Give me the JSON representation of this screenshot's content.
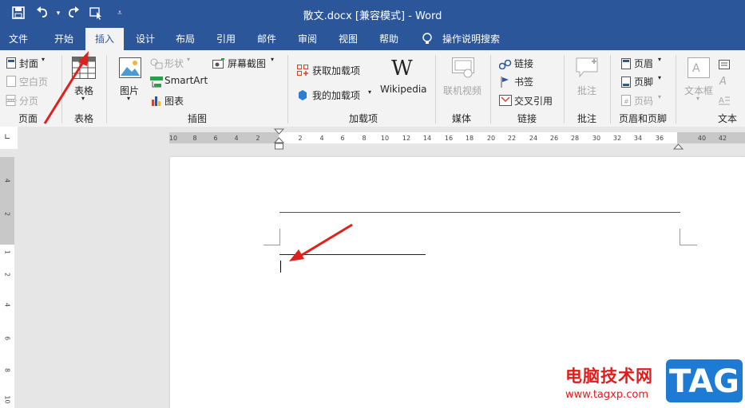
{
  "titlebar": {
    "title": "散文.docx [兼容模式]  -  Word",
    "quick_access": [
      "save-icon",
      "undo-icon",
      "redo-icon",
      "touch-mode-icon",
      "customize-icon"
    ]
  },
  "tabs": [
    "文件",
    "开始",
    "插入",
    "设计",
    "布局",
    "引用",
    "邮件",
    "审阅",
    "视图",
    "帮助"
  ],
  "active_tab": "插入",
  "tell_me": "操作说明搜索",
  "ribbon": {
    "pages": {
      "cover": "封面",
      "blank": "空白页",
      "break": "分页",
      "group": "页面"
    },
    "tables": {
      "table": "表格",
      "group": "表格"
    },
    "illustrations": {
      "pictures": "图片",
      "shapes": "形状",
      "smartart": "SmartArt",
      "chart": "图表",
      "screenshot": "屏幕截图",
      "group": "插图"
    },
    "addins": {
      "get": "获取加载项",
      "my": "我的加载项",
      "wikipedia": "Wikipedia",
      "group": "加载项"
    },
    "media": {
      "video": "联机视频",
      "group": "媒体"
    },
    "links": {
      "link": "链接",
      "bookmark": "书签",
      "crossref": "交叉引用",
      "group": "链接"
    },
    "comments": {
      "comment": "批注",
      "group": "批注"
    },
    "headerfooter": {
      "header": "页眉",
      "footer": "页脚",
      "pagenum": "页码",
      "group": "页眉和页脚"
    },
    "text": {
      "textbox": "文本框",
      "group": "文本"
    }
  },
  "ruler": {
    "left_ticks": [
      "10",
      "8",
      "6",
      "4",
      "2"
    ],
    "right_ticks": [
      "2",
      "4",
      "6",
      "8",
      "10",
      "12",
      "14",
      "16",
      "18",
      "20",
      "22",
      "24",
      "26",
      "28",
      "30",
      "32",
      "34",
      "36",
      "40",
      "42"
    ],
    "vertical_ticks": [
      "4",
      "2",
      "1",
      "2",
      "4",
      "6",
      "8",
      "10"
    ]
  },
  "watermark": {
    "site_cn": "电脑技术网",
    "site_url": "www.tagxp.com",
    "badge": "TAG"
  },
  "colors": {
    "title_bar": "#2b579a",
    "ribbon": "#f3f3f3",
    "arrow": "#e0201b"
  }
}
